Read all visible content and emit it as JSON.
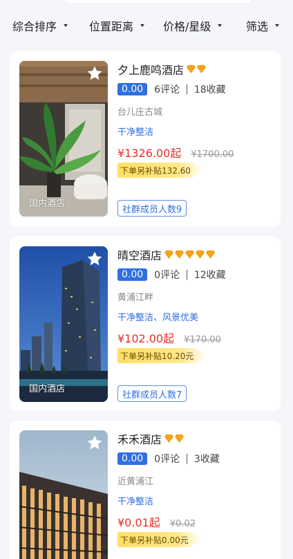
{
  "filters": [
    {
      "label": "综合排序"
    },
    {
      "label": "位置距离"
    },
    {
      "label": "价格/星级"
    },
    {
      "label": "筛选"
    }
  ],
  "hotels": [
    {
      "name": "夕上鹿鸣酒店",
      "diamonds": 2,
      "score": "0.00",
      "reviews": "6评论",
      "favorites": "18收藏",
      "location": "台儿庄古城",
      "tags": "干净整洁",
      "price": "¥1326.00起",
      "original_price": "¥1700.00",
      "subsidy": "下单另补贴132.60",
      "photo_tag": "国内酒店",
      "member_count": "社群成员人数9"
    },
    {
      "name": "晴空酒店",
      "diamonds": 5,
      "score": "0.00",
      "reviews": "0评论",
      "favorites": "12收藏",
      "location": "黄浦江畔",
      "tags": "干净整洁、风景优美",
      "price": "¥102.00起",
      "original_price": "¥170.00",
      "subsidy": "下单另补贴10.20元",
      "photo_tag": "国内酒店",
      "member_count": "社群成员人数7"
    },
    {
      "name": "禾禾酒店",
      "diamonds": 2,
      "score": "0.00",
      "reviews": "0评论",
      "favorites": "3收藏",
      "location": "近黄浦江",
      "tags": "干净整洁",
      "price": "¥0.01起",
      "original_price": "¥0.02",
      "subsidy": "下单另补贴0.00元"
    }
  ],
  "colors": {
    "accent": "#2f6fe0",
    "price": "#e5302a",
    "diamond": "#f7a21b",
    "subsidy_bg": "#ffe066",
    "page_bg": "#f4f6fa"
  },
  "icons": {
    "favorite": "star-icon",
    "rating": "diamond-icon",
    "sort_caret": "caret-down-icon"
  }
}
